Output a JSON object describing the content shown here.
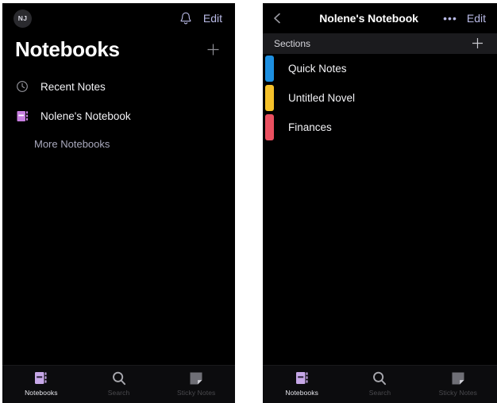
{
  "left_panel": {
    "topbar": {
      "avatar_initials": "NJ",
      "bell_icon": "bell-icon",
      "edit_label": "Edit"
    },
    "page_title": "Notebooks",
    "add_icon": "plus-icon",
    "notebooks": [
      {
        "label": "Recent Notes",
        "icon": "clock-icon",
        "icon_color": "#9a9aa2"
      },
      {
        "label": "Nolene's Notebook",
        "icon": "notebook-icon",
        "icon_color": "#c77ee0"
      }
    ],
    "more_notebooks_label": "More Notebooks"
  },
  "right_panel": {
    "navbar": {
      "back_icon": "chevron-left-icon",
      "title": "Nolene's Notebook",
      "more_label": "•••",
      "edit_label": "Edit"
    },
    "sections_header": {
      "title": "Sections",
      "add_icon": "plus-icon"
    },
    "sections": [
      {
        "label": "Quick Notes",
        "color": "#1d8fe0"
      },
      {
        "label": "Untitled Novel",
        "color": "#f5c12a"
      },
      {
        "label": "Finances",
        "color": "#ea5060"
      }
    ]
  },
  "tabbar": {
    "tabs": [
      {
        "label": "Notebooks",
        "icon": "notebook-icon",
        "active": true
      },
      {
        "label": "Search",
        "icon": "search-icon",
        "active": false
      },
      {
        "label": "Sticky Notes",
        "icon": "sticky-note-icon",
        "active": false
      }
    ]
  },
  "colors": {
    "background": "#000000",
    "accent_purple": "#c7a8e8",
    "link_lavender": "#b9bae6",
    "tab_inactive": "#4a4a4e"
  }
}
